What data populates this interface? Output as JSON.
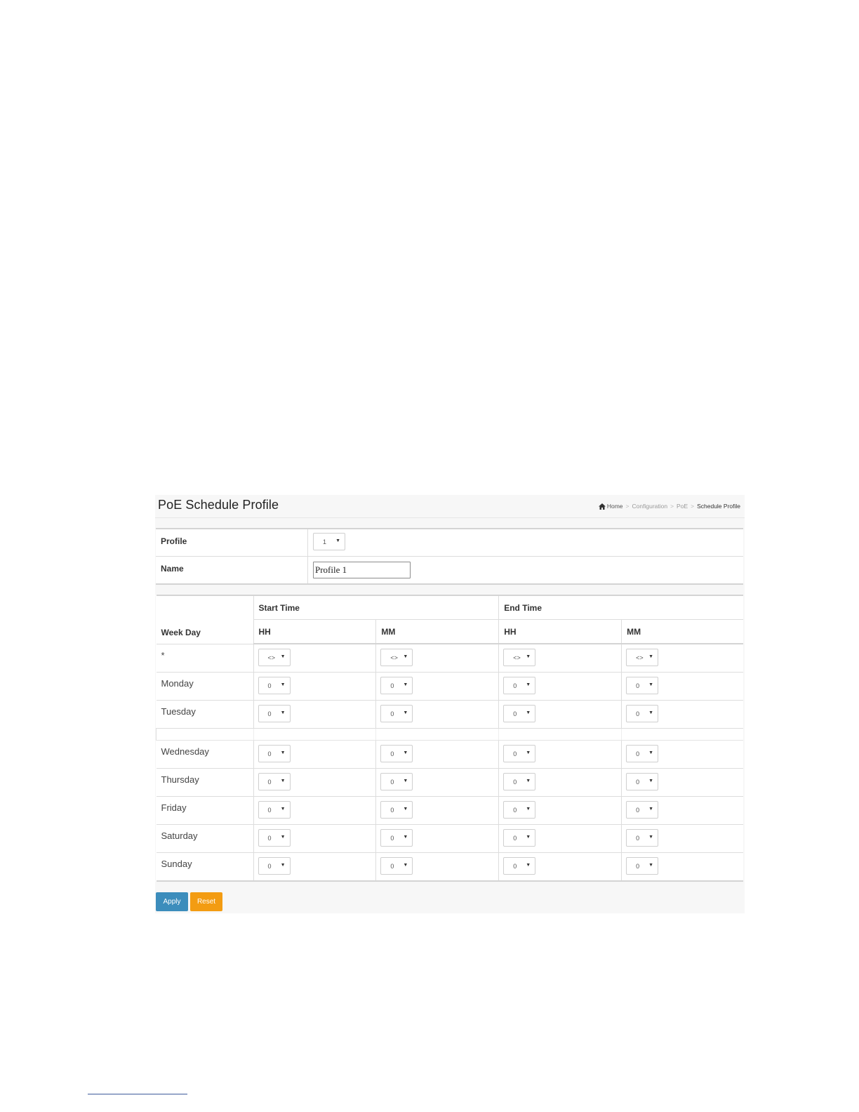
{
  "page": {
    "title": "PoE Schedule Profile"
  },
  "breadcrumb": {
    "home": "Home",
    "items": [
      "Configuration",
      "PoE"
    ],
    "current": "Schedule Profile",
    "separator": ">"
  },
  "profile_form": {
    "profile_label": "Profile",
    "profile_value": "1",
    "name_label": "Name",
    "name_value": "Profile 1"
  },
  "schedule": {
    "headers": {
      "week_day": "Week Day",
      "start_time": "Start Time",
      "end_time": "End Time",
      "hh": "HH",
      "mm": "MM"
    },
    "rows": [
      {
        "day": "*",
        "start_hh": "<>",
        "start_mm": "<>",
        "end_hh": "<>",
        "end_mm": "<>"
      },
      {
        "day": "Monday",
        "start_hh": "0",
        "start_mm": "0",
        "end_hh": "0",
        "end_mm": "0"
      },
      {
        "day": "Tuesday",
        "start_hh": "0",
        "start_mm": "0",
        "end_hh": "0",
        "end_mm": "0"
      },
      {
        "day": "Wednesday",
        "start_hh": "0",
        "start_mm": "0",
        "end_hh": "0",
        "end_mm": "0"
      },
      {
        "day": "Thursday",
        "start_hh": "0",
        "start_mm": "0",
        "end_hh": "0",
        "end_mm": "0"
      },
      {
        "day": "Friday",
        "start_hh": "0",
        "start_mm": "0",
        "end_hh": "0",
        "end_mm": "0"
      },
      {
        "day": "Saturday",
        "start_hh": "0",
        "start_mm": "0",
        "end_hh": "0",
        "end_mm": "0"
      },
      {
        "day": "Sunday",
        "start_hh": "0",
        "start_mm": "0",
        "end_hh": "0",
        "end_mm": "0"
      }
    ]
  },
  "buttons": {
    "apply": "Apply",
    "reset": "Reset"
  },
  "icons": {
    "home": "home-icon",
    "dropdown": "chevron-down-icon"
  },
  "colors": {
    "apply": "#3c8dbc",
    "reset": "#f39c12"
  }
}
